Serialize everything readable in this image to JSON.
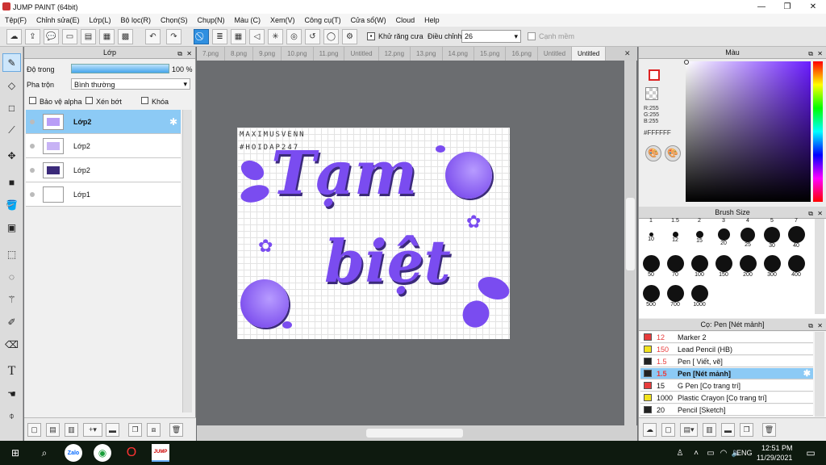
{
  "window": {
    "title": "JUMP PAINT (64bit)"
  },
  "menu": [
    "Tệp(F)",
    "Chỉnh sửa(E)",
    "Lớp(L)",
    "Bộ lọc(R)",
    "Chọn(S)",
    "Chụp(N)",
    "Màu (C)",
    "Xem(V)",
    "Công cụ(T)",
    "Cửa sổ(W)",
    "Cloud",
    "Help"
  ],
  "toolbar": {
    "antialias_label": "Khử răng cưa",
    "adjust_label": "Điều chỉnh",
    "adjust_value": "26",
    "smooth_label": "Cạnh mềm"
  },
  "layer_panel": {
    "title": "Lớp",
    "opacity_label": "Độ trong",
    "opacity_value": "100 %",
    "blend_label": "Pha trộn",
    "blend_value": "Bình thường",
    "protect_alpha": "Bảo vệ alpha",
    "clipping": "Xén bớt",
    "lock": "Khóa",
    "layers": [
      {
        "name": "Lớp2",
        "selected": true
      },
      {
        "name": "Lớp2"
      },
      {
        "name": "Lớp2"
      },
      {
        "name": "Lớp1"
      }
    ]
  },
  "tabs": [
    {
      "label": "7.png"
    },
    {
      "label": "8.png"
    },
    {
      "label": "9.png"
    },
    {
      "label": "10.png"
    },
    {
      "label": "11.png"
    },
    {
      "label": "Untitled"
    },
    {
      "label": "12.png"
    },
    {
      "label": "13.png"
    },
    {
      "label": "14.png"
    },
    {
      "label": "15.png"
    },
    {
      "label": "16.png"
    },
    {
      "label": "Untitled"
    },
    {
      "label": "Untitled",
      "active": true
    }
  ],
  "canvas": {
    "watermark1": "MAXIMUSVENN",
    "watermark2": "#HOIDAP247",
    "text1": "Tạm",
    "text2": "biệt",
    "accent": "#7a4cf0"
  },
  "color_panel": {
    "title": "Màu",
    "r": "R:255",
    "g": "G:255",
    "b": "B:255",
    "hex": "#FFFFFF"
  },
  "brush_size": {
    "title": "Brush Size",
    "sizes": [
      "1",
      "1.5",
      "2",
      "3",
      "4",
      "5",
      "7",
      "10",
      "12",
      "15",
      "20",
      "25",
      "30",
      "40",
      "50",
      "70",
      "100",
      "150",
      "200",
      "300",
      "400",
      "500",
      "700",
      "1000"
    ]
  },
  "brush_panel": {
    "title": "Cọ: Pen [Nét mảnh]",
    "brushes": [
      {
        "size": "12",
        "name": "Marker 2",
        "color": "#e83c3c"
      },
      {
        "size": "150",
        "name": "Lead Pencil (HB)",
        "color": "#f2e21c"
      },
      {
        "size": "1.5",
        "name": "Pen [ Viết, vẽ]",
        "color": "#222222"
      },
      {
        "size": "1.5",
        "name": "Pen [Nét mảnh]",
        "color": "#222222",
        "selected": true
      },
      {
        "size": "15",
        "name": "G Pen [Cọ trang trí]",
        "color": "#e83c3c"
      },
      {
        "size": "1000",
        "name": "Plastic Crayon [Cọ trang trí]",
        "color": "#f2e21c"
      },
      {
        "size": "20",
        "name": "Pencil [Sketch]",
        "color": "#222222"
      }
    ]
  },
  "taskbar": {
    "time": "12:51 PM",
    "date": "11/29/2021",
    "lang": "ENG"
  }
}
